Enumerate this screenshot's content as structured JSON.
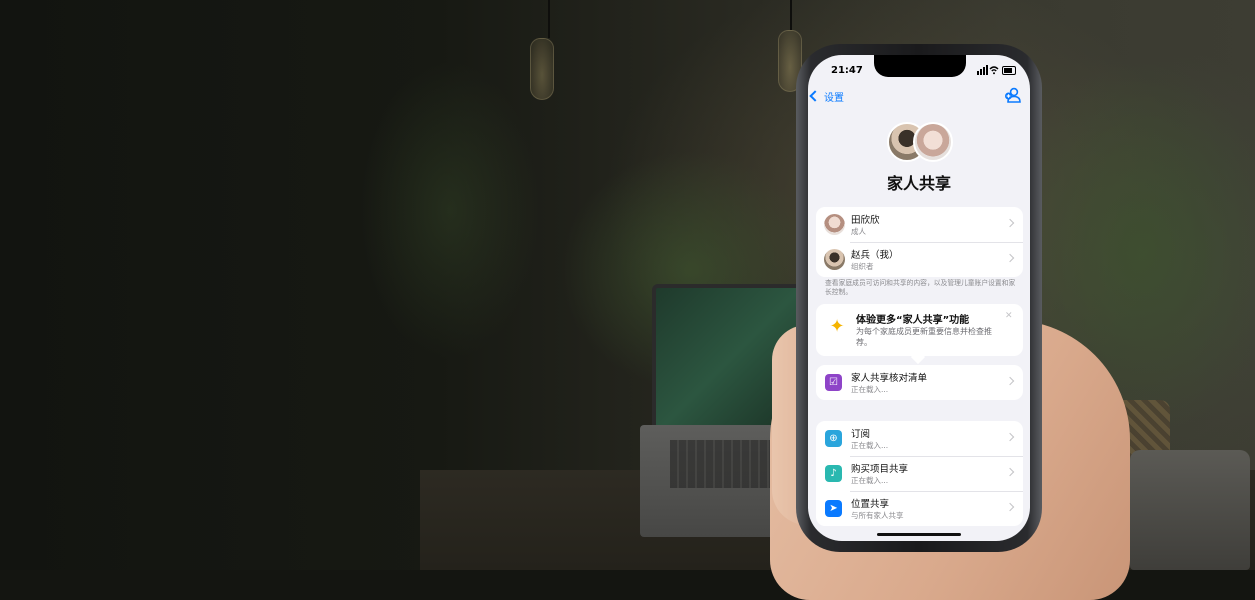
{
  "status_bar": {
    "time": "21:47"
  },
  "nav": {
    "back_label": "设置"
  },
  "header": {
    "title": "家人共享"
  },
  "members": [
    {
      "name": "田欣欣",
      "role": "成人"
    },
    {
      "name": "赵兵（我）",
      "role": "组织者"
    }
  ],
  "members_footnote": "查看家庭成员可访问和共享的内容，以及管理儿童账户设置和家长控制。",
  "promo": {
    "title": "体验更多“家人共享”功能",
    "body": "为每个家庭成员更新重要信息并检查推荐。"
  },
  "checklist": {
    "title": "家人共享核对清单",
    "status": "正在载入..."
  },
  "features": [
    {
      "title": "订阅",
      "status": "正在载入...",
      "icon": "subscription-icon",
      "color": "#2aa5dc"
    },
    {
      "title": "购买项目共享",
      "status": "正在载入...",
      "icon": "purchase-sharing-icon",
      "color": "#2ab8b0"
    },
    {
      "title": "位置共享",
      "status": "与所有家人共享",
      "icon": "location-icon",
      "color": "#0a7aff"
    }
  ],
  "colors": {
    "accent": "#0a7aff",
    "checklist_icon": "#8e44c8",
    "promo_icon": "#f5b400"
  }
}
